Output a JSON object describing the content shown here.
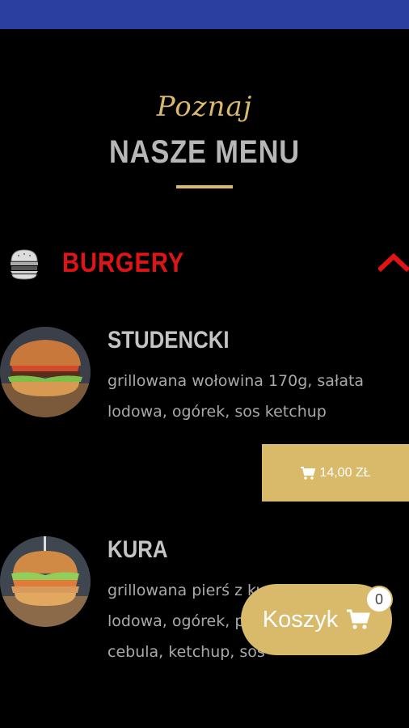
{
  "header": {
    "script_title": "Poznaj",
    "title": "NASZE MENU"
  },
  "category": {
    "label": "BURGERY",
    "icon": "burger-icon",
    "accent_color": "#e01414"
  },
  "items": [
    {
      "name": "STUDENCKI",
      "description": "grillowana wołowina 170g, sałata lodowa, ogórek, sos ketchup",
      "price": "14,00 ZŁ",
      "image": "burger-photo"
    },
    {
      "name": "KURA",
      "description": "grillowana pierś z kurczaka, sałata lodowa, ogórek, pomidor, czerwona cebula, ketchup, sos",
      "image": "chicken-burger-photo"
    }
  ],
  "cart": {
    "label": "Koszyk",
    "count": "0"
  },
  "colors": {
    "gold": "#d9b96a",
    "status_bar": "#2b3fa0",
    "background": "#000000"
  }
}
